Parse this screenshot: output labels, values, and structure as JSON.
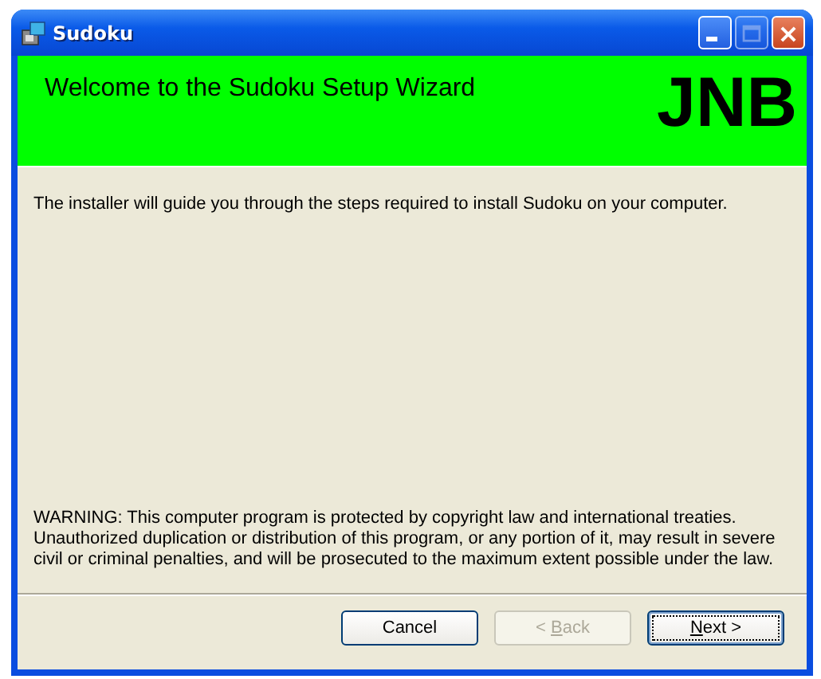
{
  "window": {
    "title": "Sudoku"
  },
  "header": {
    "title": "Welcome to the Sudoku Setup Wizard",
    "logo": "JNB"
  },
  "intro": "The installer will guide you through the steps required to install Sudoku on your computer.",
  "warning": "WARNING: This computer program is protected by copyright law and international treaties. Unauthorized duplication or distribution of this program, or any portion of it, may result in severe civil or criminal penalties, and will be prosecuted to the maximum extent possible under the law.",
  "buttons": [
    {
      "before": "Cancel",
      "disabled": false,
      "default": false
    },
    {
      "before": "< ",
      "key": "B",
      "after": "ack",
      "disabled": true,
      "default": false
    },
    {
      "key": "N",
      "after": "ext >",
      "disabled": false,
      "default": true
    }
  ]
}
